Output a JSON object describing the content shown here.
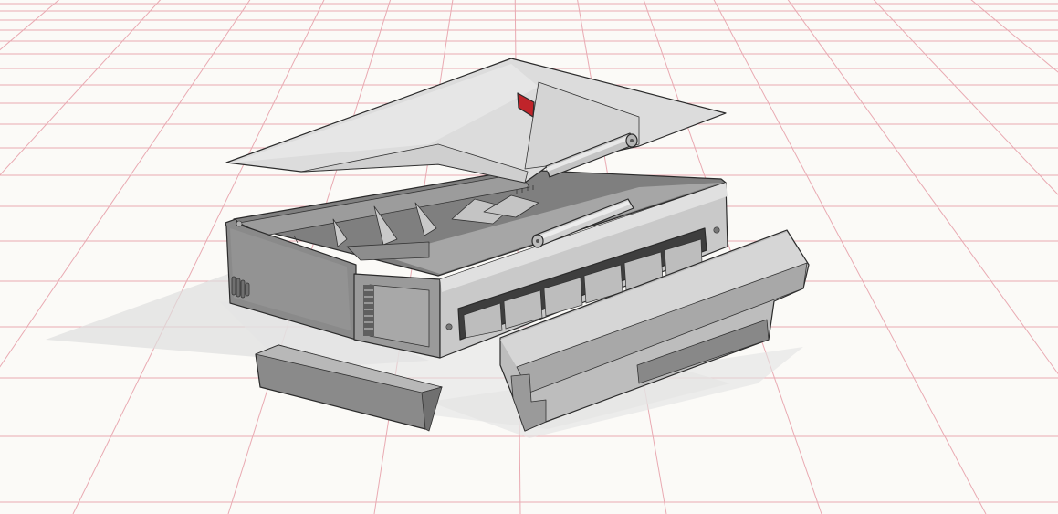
{
  "view": {
    "kind": "3d-cad-viewport",
    "background_color": "#fbfaf7",
    "grid_color": "#e9aab2",
    "accent_color": "#c0242a"
  },
  "model": {
    "parts": [
      {
        "name": "lid",
        "color": "#dcdcdc"
      },
      {
        "name": "base-enclosure",
        "color": "#8f8f8f"
      },
      {
        "name": "hinge-pin",
        "color": "#d0d0d0"
      },
      {
        "name": "front-cover-panel",
        "color": "#bdbdbd"
      },
      {
        "name": "side-cover-strip",
        "color": "#8a8a8a"
      }
    ]
  }
}
